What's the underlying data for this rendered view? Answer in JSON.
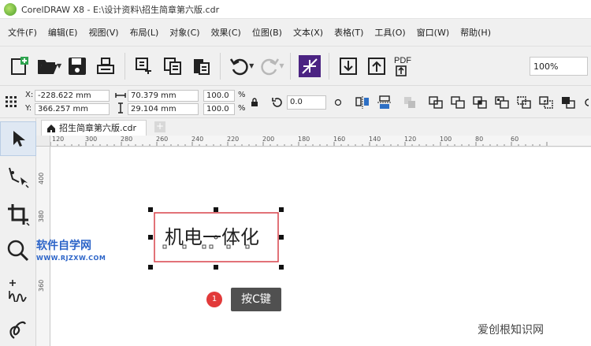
{
  "window": {
    "title": "CorelDRAW X8 - E:\\设计资料\\招生简章第六版.cdr"
  },
  "menu": [
    "文件(F)",
    "编辑(E)",
    "视图(V)",
    "布局(L)",
    "对象(C)",
    "效果(C)",
    "位图(B)",
    "文本(X)",
    "表格(T)",
    "工具(O)",
    "窗口(W)",
    "帮助(H)"
  ],
  "toolbar": {
    "zoom": "100%"
  },
  "property_bar": {
    "x_label": "X:",
    "x_value": "-228.622 mm",
    "y_label": "Y:",
    "y_value": "366.257 mm",
    "width_value": "70.379 mm",
    "height_value": "29.104 mm",
    "scale_x": "100.0",
    "scale_y": "100.0",
    "percent": "%",
    "rotation": "0.0"
  },
  "document_tab": {
    "label": "招生简章第六版.cdr",
    "add": "+"
  },
  "ruler_h": [
    "120",
    "300",
    "280",
    "260",
    "240",
    "220",
    "200",
    "180",
    "160",
    "140",
    "120",
    "100",
    "80",
    "60"
  ],
  "ruler_v": [
    "400",
    "380",
    "360"
  ],
  "canvas": {
    "text_object": "机电一体化"
  },
  "watermark": {
    "title": "软件自学网",
    "url": "WWW.RJZXW.COM"
  },
  "annotation": {
    "step": "1",
    "label": "按C键"
  },
  "site_watermark": "爱创根知识网"
}
